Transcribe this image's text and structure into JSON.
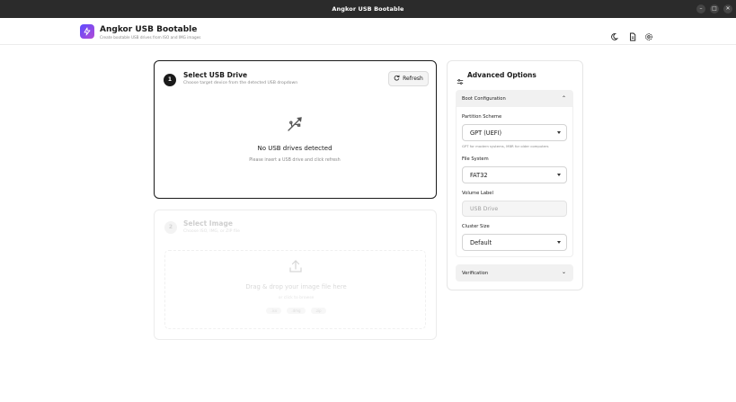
{
  "window": {
    "title": "Angkor USB Bootable",
    "controls": [
      "minimize-icon",
      "maximize-icon",
      "close-icon"
    ]
  },
  "header": {
    "app_name": "Angkor USB Bootable",
    "app_subtitle": "Create bootable USB drives from ISO and IMG images",
    "icons": [
      "moon-icon",
      "document-icon",
      "settings-icon"
    ]
  },
  "usb_card": {
    "step": "1",
    "title": "Select USB Drive",
    "subtitle": "Choose target device from the detected USB dropdown",
    "refresh_label": "Refresh",
    "empty_title": "No USB drives detected",
    "empty_subtitle": "Please insert a USB drive and click refresh"
  },
  "image_card": {
    "step": "2",
    "title": "Select Image",
    "subtitle": "Choose ISO, IMG, or ZIP file",
    "drop_title": "Drag & drop your image file here",
    "drop_subtitle": "or click to browse",
    "extensions": [
      ".iso",
      ".dmg",
      ".zip"
    ]
  },
  "advanced": {
    "title": "Advanced Options",
    "boot_section": "Boot Configuration",
    "partition_label": "Partition Scheme",
    "partition_value": "GPT (UEFI)",
    "partition_help": "GPT for modern systems, MBR for older computers",
    "filesystem_label": "File System",
    "filesystem_value": "FAT32",
    "volume_label": "Volume Label",
    "volume_placeholder": "USB Drive",
    "cluster_label": "Cluster Size",
    "cluster_value": "Default",
    "verification_section": "Verification"
  },
  "colors": {
    "titlebar": "#2b2b2b",
    "accent_gradient_start": "#5b4bff",
    "accent_gradient_end": "#b24bd6",
    "active_border": "#1a1a1a"
  }
}
